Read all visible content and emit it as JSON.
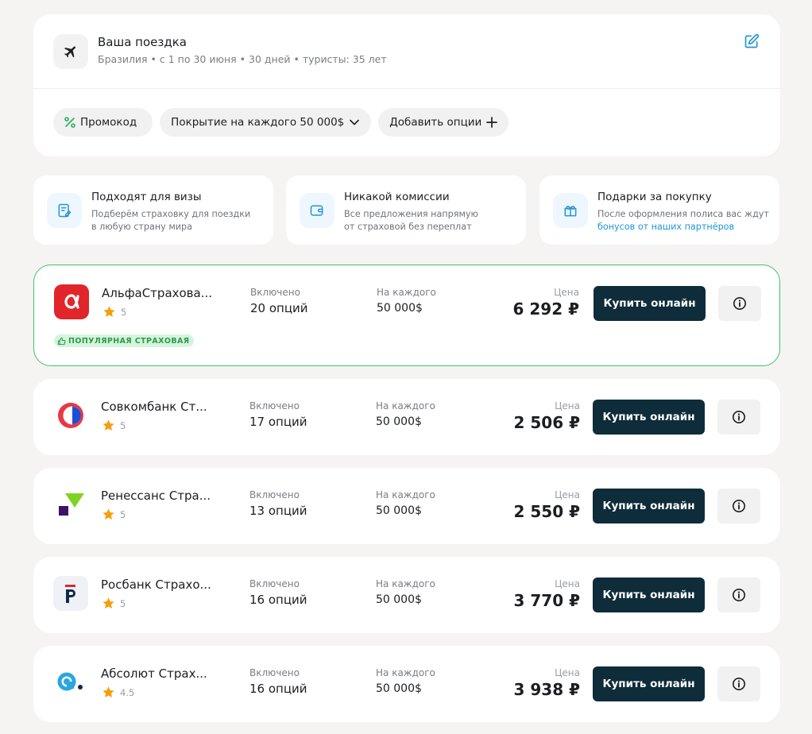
{
  "trip": {
    "title": "Ваша поездка",
    "subtitle": "Бразилия • с 1 по 30 июня • 30 дней • туристы: 35 лет",
    "icons": {
      "main": "airplane-icon",
      "edit": "edit-icon"
    }
  },
  "chips": {
    "promo": "Промокод",
    "coverage": "Покрытие на каждого 50 000$",
    "options": "Добавить опции"
  },
  "features": [
    {
      "title": "Подходят для визы",
      "line1": "Подберём страховку для поездки",
      "line2": "в любую страну мира",
      "icon": "document-icon"
    },
    {
      "title": "Никакой комиссии",
      "line1": "Все предложения напрямую",
      "line2": "от страховой без переплат",
      "icon": "wallet-icon"
    },
    {
      "title": "Подарки за покупку",
      "line1": "После оформления полиса вас ждут",
      "line2": "бонусов от наших партнёров",
      "icon": "gift-icon"
    }
  ],
  "labels": {
    "included": "Включено",
    "per_person": "На каждого",
    "price": "Цена",
    "buy": "Купить онлайн"
  },
  "offers": [
    {
      "company": "АльфаСтрахова...",
      "rating": "5",
      "options": "20 опций",
      "coverage": "50 000$",
      "price": "6 292 ₽",
      "badge": "ПОПУЛЯРНАЯ СТРАХОВАЯ"
    },
    {
      "company": "Совкомбанк Ст...",
      "rating": "5",
      "options": "17 опций",
      "coverage": "50 000$",
      "price": "2 506 ₽"
    },
    {
      "company": "Ренессанс Стра...",
      "rating": "5",
      "options": "13 опций",
      "coverage": "50 000$",
      "price": "2 550 ₽"
    },
    {
      "company": "Росбанк Страхо...",
      "rating": "5",
      "options": "16 опций",
      "coverage": "50 000$",
      "price": "3 770 ₽"
    },
    {
      "company": "Абсолют Страх...",
      "rating": "4.5",
      "options": "16 опций",
      "coverage": "50 000$",
      "price": "3 938 ₽"
    }
  ],
  "colors": {
    "accent_dark": "#0f2c3a",
    "featured_border": "#3ec26a",
    "star": "#f59e0b",
    "link": "#2196d6"
  }
}
